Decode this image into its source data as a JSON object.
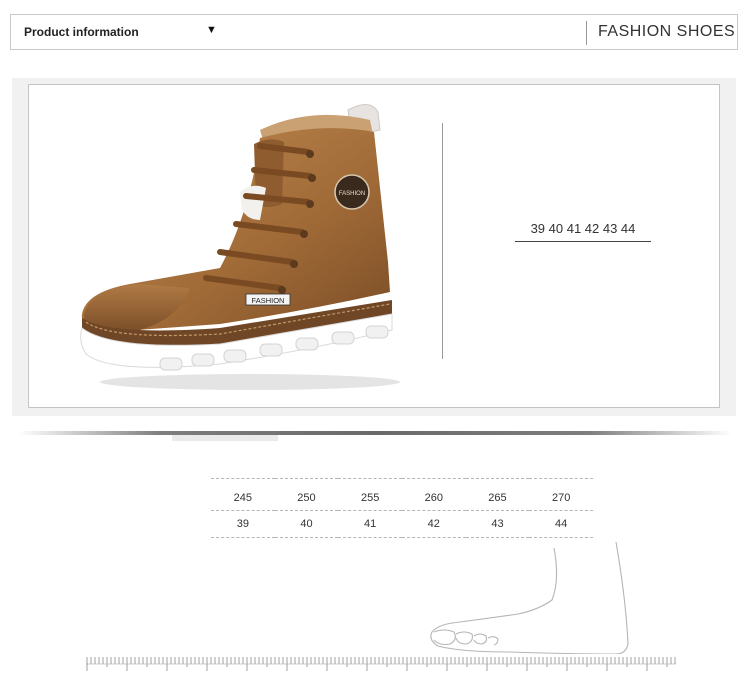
{
  "header": {
    "product_info": "Product information",
    "dropdown_glyph": "▼",
    "brand": "FASHION SHOES"
  },
  "product": {
    "image_name": "high-top-boot",
    "tag_text": "FASHION",
    "badge_text": "FASHION",
    "sizes_text": "39 40 41 42 43 44",
    "colors": {
      "leather": "#a06a37",
      "sole": "#ffffff",
      "welt": "#7a5030"
    }
  },
  "size_table": {
    "lengths": [
      "245",
      "250",
      "255",
      "260",
      "265",
      "270"
    ],
    "sizes": [
      "39",
      "40",
      "41",
      "42",
      "43",
      "44"
    ]
  },
  "foot_illustration": "foot-outline",
  "ruler": "measuring-ruler"
}
